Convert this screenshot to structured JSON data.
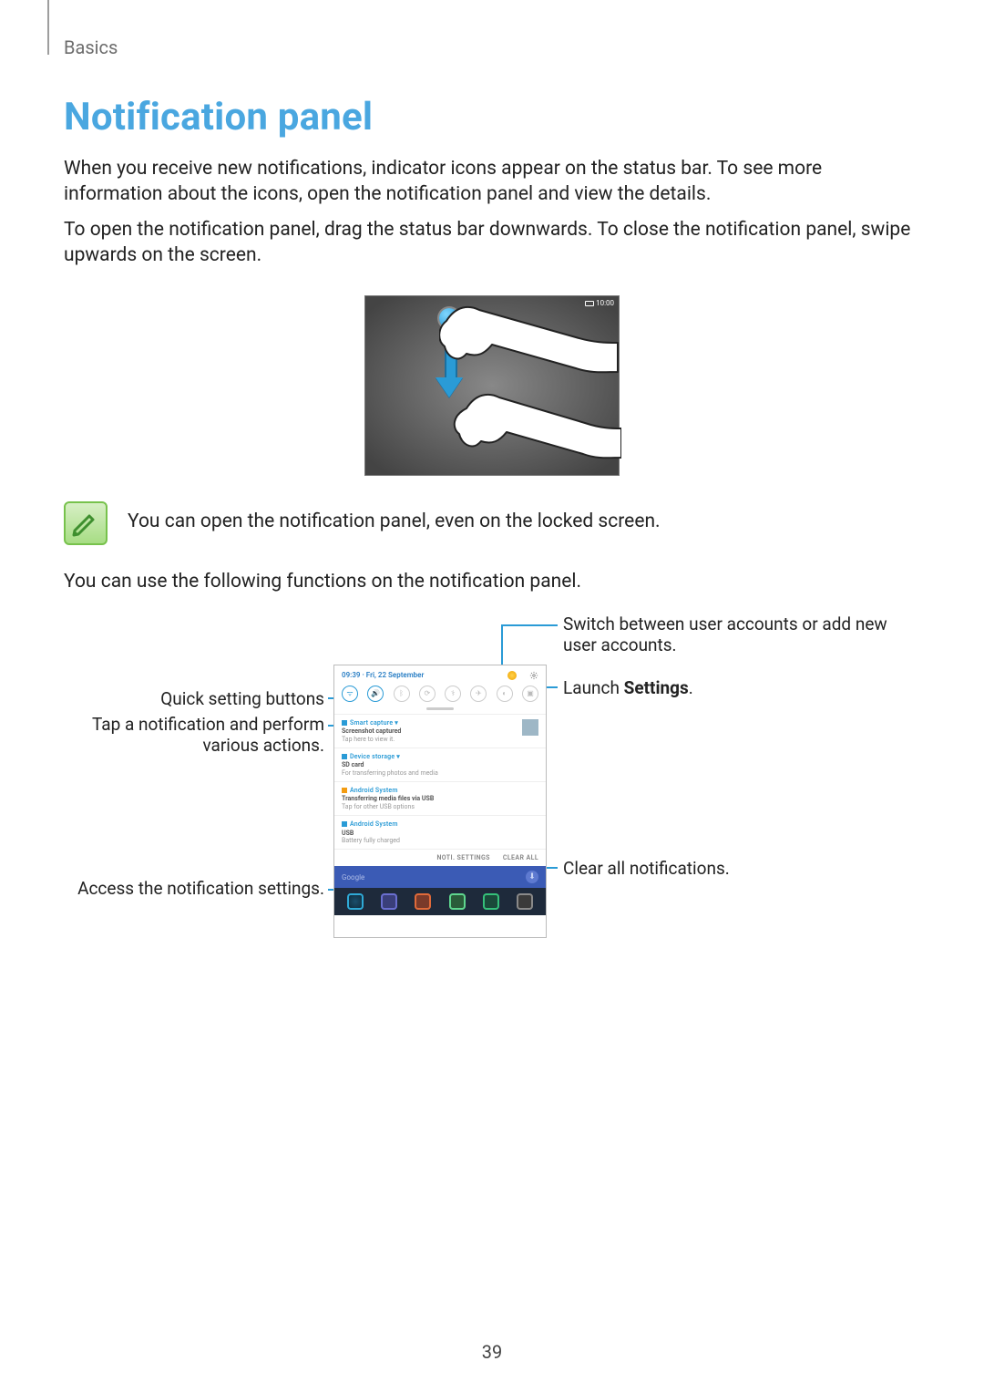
{
  "section": "Basics",
  "title": "Notification panel",
  "para1": "When you receive new notifications, indicator icons appear on the status bar. To see more information about the icons, open the notification panel and view the details.",
  "para2": "To open the notification panel, drag the status bar downwards. To close the notification panel, swipe upwards on the screen.",
  "fig_status_time": "10:00",
  "note_text": "You can open the notification panel, even on the locked screen.",
  "para3": "You can use the following functions on the notification panel.",
  "callouts": {
    "switch_users": "Switch between user accounts or add new user accounts.",
    "launch_settings_prefix": "Launch ",
    "launch_settings_bold": "Settings",
    "launch_settings_suffix": ".",
    "quick_settings": "Quick setting buttons",
    "tap_notification": "Tap a notification and perform various actions.",
    "clear_all": "Clear all notifications.",
    "access_settings": "Access the notification settings."
  },
  "panel": {
    "datetime": "09:39 · Fri, 22 September",
    "footer_left": "NOTI. SETTINGS",
    "footer_right": "CLEAR ALL",
    "search": "Google"
  },
  "page_number": "39"
}
